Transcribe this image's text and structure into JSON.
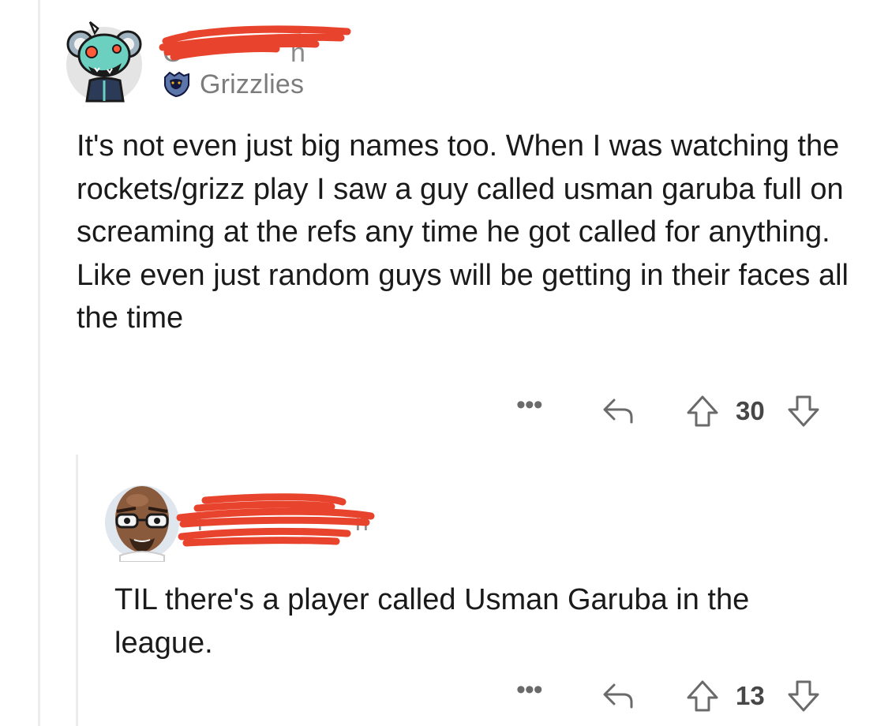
{
  "comments": [
    {
      "username": "",
      "username_redacted": true,
      "flair": {
        "icon": "grizzlies-logo-icon",
        "text": "Grizzlies"
      },
      "avatar": "koala-zombie-avatar",
      "body": "It's not even just big names too. When I was watching the rockets/grizz play I saw a guy called usman garuba full on screaming at the refs any time he got called for anything. Like even just random guys will be getting in their faces all the time",
      "actions": {
        "more_label": "•••",
        "votes": "30"
      }
    },
    {
      "username": "",
      "username_redacted": true,
      "avatar": "bald-man-glasses-avatar",
      "body": "TIL there's a player called Usman Garuba in the league.",
      "actions": {
        "more_label": "•••",
        "votes": "13"
      }
    }
  ],
  "colors": {
    "redaction": "#e8432c",
    "text": "#1a1a1b",
    "muted": "#7c7c7c",
    "thread_line": "#ececec"
  }
}
